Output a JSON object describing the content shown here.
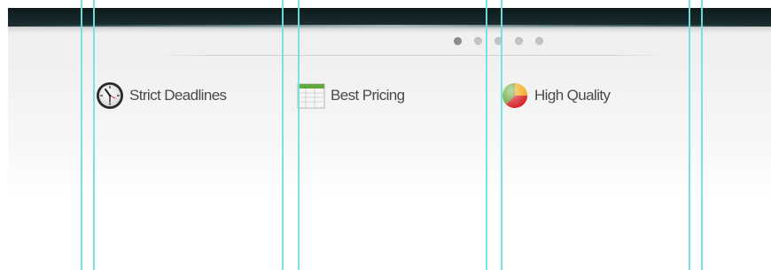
{
  "header": {
    "bar_color": "#132325"
  },
  "slider": {
    "page_count": 5,
    "active_index": 0,
    "dots": [
      {
        "label": "slide-1",
        "active": true
      },
      {
        "label": "slide-2",
        "active": false
      },
      {
        "label": "slide-3",
        "active": false
      },
      {
        "label": "slide-4",
        "active": false
      },
      {
        "label": "slide-5",
        "active": false
      }
    ]
  },
  "features": [
    {
      "icon": "clock-icon",
      "label": "Strict Deadlines"
    },
    {
      "icon": "spreadsheet-icon",
      "label": "Best Pricing"
    },
    {
      "icon": "pie-chart-icon",
      "label": "High Quality"
    }
  ],
  "guides": {
    "color": "#6ee3e3",
    "count": 8
  }
}
